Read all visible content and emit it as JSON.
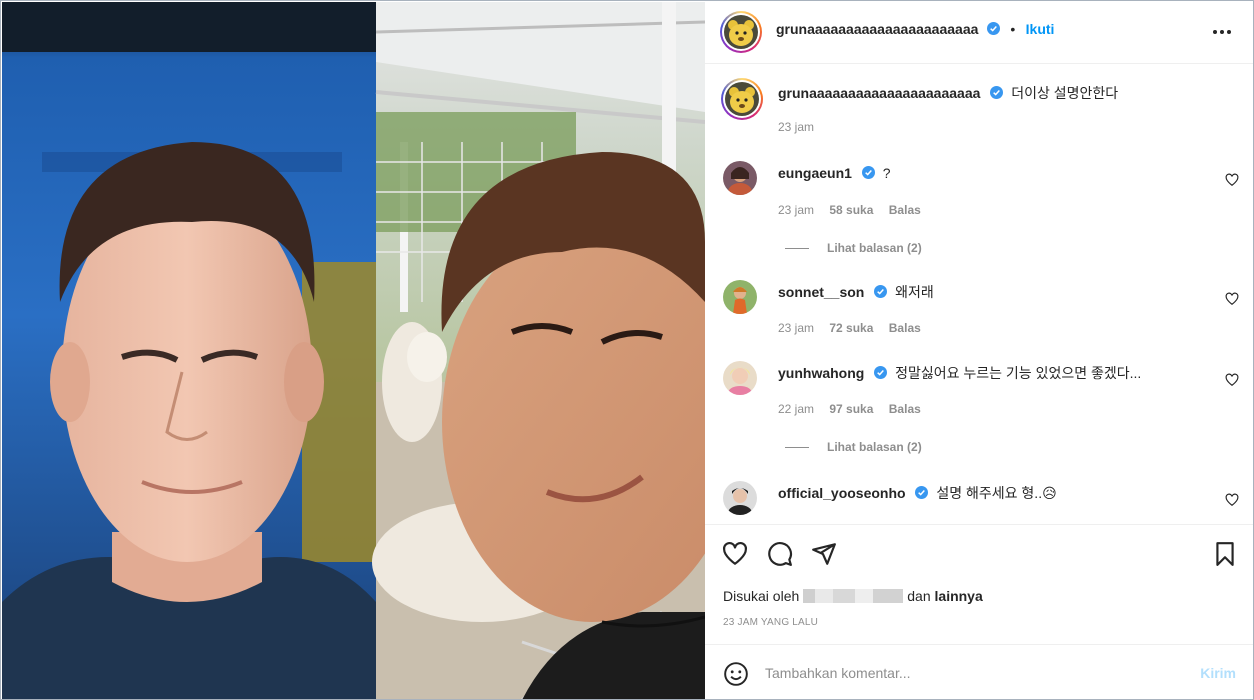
{
  "colors": {
    "accent": "#0095f6",
    "verified": "#3897f0",
    "muted": "#8e8e8e",
    "disabled_link": "#b2dffc"
  },
  "header": {
    "username": "grunaaaaaaaaaaaaaaaaaaaaaa",
    "separator": "•",
    "follow_label": "Ikuti",
    "more_icon": "more-horizontal-icon"
  },
  "caption": {
    "username": "grunaaaaaaaaaaaaaaaaaaaaaa",
    "text": "더이상 설명안한다",
    "time": "23 jam"
  },
  "comments": [
    {
      "username": "eungaeun1",
      "text": "?",
      "time": "23 jam",
      "likes": "58 suka",
      "reply": "Balas",
      "view_replies": "Lihat balasan (2)"
    },
    {
      "username": "sonnet__son",
      "text": "왜저래",
      "time": "23 jam",
      "likes": "72 suka",
      "reply": "Balas"
    },
    {
      "username": "yunhwahong",
      "text": "정말싫어요 누르는 기능 있었으면 좋겠다...",
      "time": "22 jam",
      "likes": "97 suka",
      "reply": "Balas",
      "view_replies": "Lihat balasan (2)"
    },
    {
      "username": "official_yooseonho",
      "text": "설명 해주세요 형..😥"
    }
  ],
  "actions": {
    "liked_prefix": "Disukai oleh",
    "liked_and": "dan",
    "liked_others": "lainnya",
    "time_ago": "23 JAM YANG LALU"
  },
  "comment_box": {
    "placeholder": "Tambahkan komentar...",
    "post_label": "Kirim"
  }
}
